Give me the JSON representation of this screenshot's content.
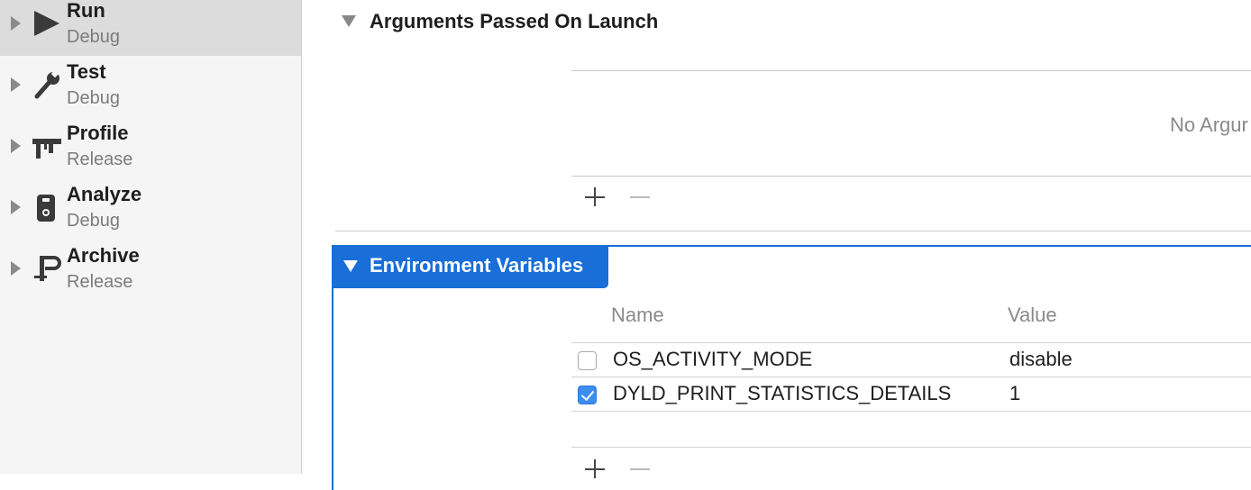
{
  "sidebar": {
    "items": [
      {
        "name": "Run",
        "config": "Debug",
        "icon": "play-icon",
        "selected": true
      },
      {
        "name": "Test",
        "config": "Debug",
        "icon": "wrench-icon",
        "selected": false
      },
      {
        "name": "Profile",
        "config": "Release",
        "icon": "instruments-icon",
        "selected": false
      },
      {
        "name": "Analyze",
        "config": "Debug",
        "icon": "analyze-icon",
        "selected": false
      },
      {
        "name": "Archive",
        "config": "Release",
        "icon": "archive-icon",
        "selected": false
      }
    ]
  },
  "arguments": {
    "title": "Arguments Passed On Launch",
    "empty_text": "No Argur"
  },
  "environment": {
    "title": "Environment Variables",
    "columns": {
      "name": "Name",
      "value": "Value"
    },
    "rows": [
      {
        "name": "OS_ACTIVITY_MODE",
        "value": "disable",
        "enabled": false
      },
      {
        "name": "DYLD_PRINT_STATISTICS_DETAILS",
        "value": "1",
        "enabled": true
      }
    ]
  },
  "colors": {
    "accent": "#1a6ed8",
    "checkbox_checked": "#3b8df0",
    "sidebar_selected": "#dcdcdc"
  }
}
